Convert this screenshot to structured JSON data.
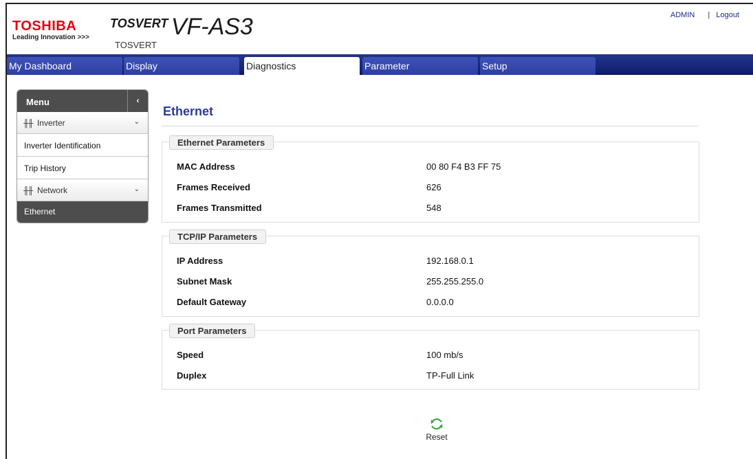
{
  "header": {
    "brand": "TOSHIBA",
    "brand_tagline": "Leading Innovation >>>",
    "product_prefix": "TOSVERT",
    "product_model": "VF-AS3",
    "sub_brand": "TOSVERT",
    "user": "ADMIN",
    "separator": "|",
    "logout": "Logout"
  },
  "tabs": [
    {
      "label": "My Dashboard",
      "active": false
    },
    {
      "label": "Display",
      "active": false
    },
    {
      "label": "Diagnostics",
      "active": true
    },
    {
      "label": "Parameter",
      "active": false
    },
    {
      "label": "Setup",
      "active": false
    }
  ],
  "sidebar": {
    "title": "Menu",
    "collapse_glyph": "‹",
    "groups": [
      {
        "label": "Inverter",
        "items": [
          "Inverter Identification",
          "Trip History"
        ]
      },
      {
        "label": "Network",
        "items": [
          "Ethernet"
        ]
      }
    ],
    "active_item": "Ethernet"
  },
  "page": {
    "title": "Ethernet",
    "sections": [
      {
        "legend": "Ethernet Parameters",
        "rows": [
          {
            "label": "MAC Address",
            "value": "00 80 F4 B3 FF 75"
          },
          {
            "label": "Frames Received",
            "value": "626"
          },
          {
            "label": "Frames Transmitted",
            "value": "548"
          }
        ]
      },
      {
        "legend": "TCP/IP Parameters",
        "rows": [
          {
            "label": "IP Address",
            "value": "192.168.0.1"
          },
          {
            "label": "Subnet Mask",
            "value": "255.255.255.0"
          },
          {
            "label": "Default Gateway",
            "value": "0.0.0.0"
          }
        ]
      },
      {
        "legend": "Port Parameters",
        "rows": [
          {
            "label": "Speed",
            "value": "100 mb/s"
          },
          {
            "label": "Duplex",
            "value": "TP-Full Link"
          }
        ]
      }
    ],
    "reset_label": "Reset"
  },
  "colors": {
    "brand_red": "#e60012",
    "nav_blue": "#1b2a8c",
    "title_blue": "#2c3a9a",
    "menu_dark": "#4d4d4d",
    "reset_green": "#3daa4a"
  },
  "icons": {
    "group_icon": "waveform-icon",
    "chevron": "chevron-down-icon",
    "reset": "refresh-icon"
  }
}
